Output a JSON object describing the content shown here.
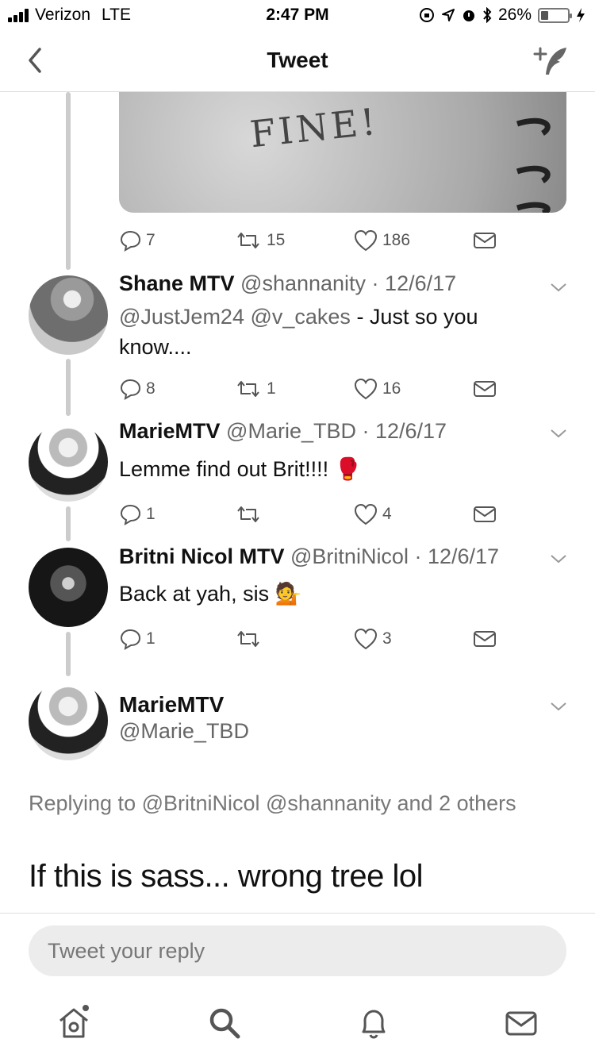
{
  "status_bar": {
    "carrier": "Verizon",
    "network": "LTE",
    "time": "2:47 PM",
    "battery": "26%"
  },
  "nav": {
    "title": "Tweet"
  },
  "tweets": [
    {
      "actions": {
        "replies": "7",
        "retweets": "15",
        "likes": "186"
      }
    },
    {
      "name": "Shane MTV",
      "meta": "@shannanity · 12/6/17",
      "mentions": "@JustJem24 @v_cakes",
      "text": " - Just so you know....",
      "actions": {
        "replies": "8",
        "retweets": "1",
        "likes": "16"
      }
    },
    {
      "name": "MarieMTV",
      "meta": "@Marie_TBD · 12/6/17",
      "text": "Lemme find out Brit!!!! 🥊",
      "actions": {
        "replies": "1",
        "retweets": "",
        "likes": "4"
      }
    },
    {
      "name": "Britni Nicol MTV",
      "meta": "@BritniNicol · 12/6/17",
      "text": "Back at yah, sis 💁",
      "actions": {
        "replies": "1",
        "retweets": "",
        "likes": "3"
      }
    }
  ],
  "focused_tweet": {
    "name": "MarieMTV",
    "handle": "@Marie_TBD",
    "replying_to": "Replying to @BritniNicol @shannanity and 2 others",
    "text": "If this is sass... wrong tree lol"
  },
  "reply": {
    "placeholder": "Tweet your reply"
  },
  "media": {
    "scribble": "FINE!"
  }
}
